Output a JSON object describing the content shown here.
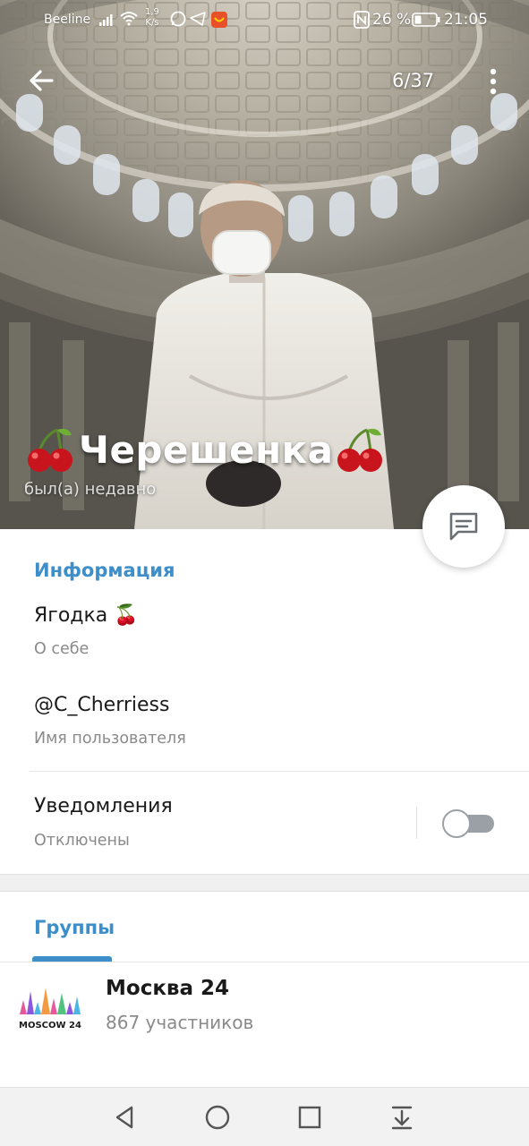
{
  "status_bar": {
    "carrier": "Beeline",
    "net_speed_value": "1,9",
    "net_speed_unit": "K/s",
    "battery_percent": "26 %",
    "time": "21:05"
  },
  "header": {
    "photo_counter": "6/37",
    "name": "Черешенка",
    "name_decoration": "cherry-emoji",
    "last_seen": "был(а) недавно"
  },
  "info": {
    "section_title": "Информация",
    "bio": "Ягодка 🍒",
    "bio_label": "О себе",
    "username": "@C_Cherriess",
    "username_label": "Имя пользователя",
    "notifications": "Уведомления",
    "notifications_status": "Отключены",
    "notifications_enabled": false
  },
  "groups": {
    "section_title": "Группы",
    "items": [
      {
        "name": "Москва 24",
        "members": "867 участников",
        "avatar_text": "MOSCOW 24"
      }
    ]
  },
  "colors": {
    "accent": "#3d8ec9",
    "text_primary": "#1a1a1a",
    "text_secondary": "#8a8a8a",
    "toggle_off": "#9aa0a6"
  },
  "icons": {
    "back": "arrow-left-icon",
    "more": "vertical-dots-icon",
    "message": "message-icon",
    "nav": [
      "back-triangle-icon",
      "home-circle-icon",
      "recents-square-icon",
      "notification-pulldown-icon"
    ]
  }
}
